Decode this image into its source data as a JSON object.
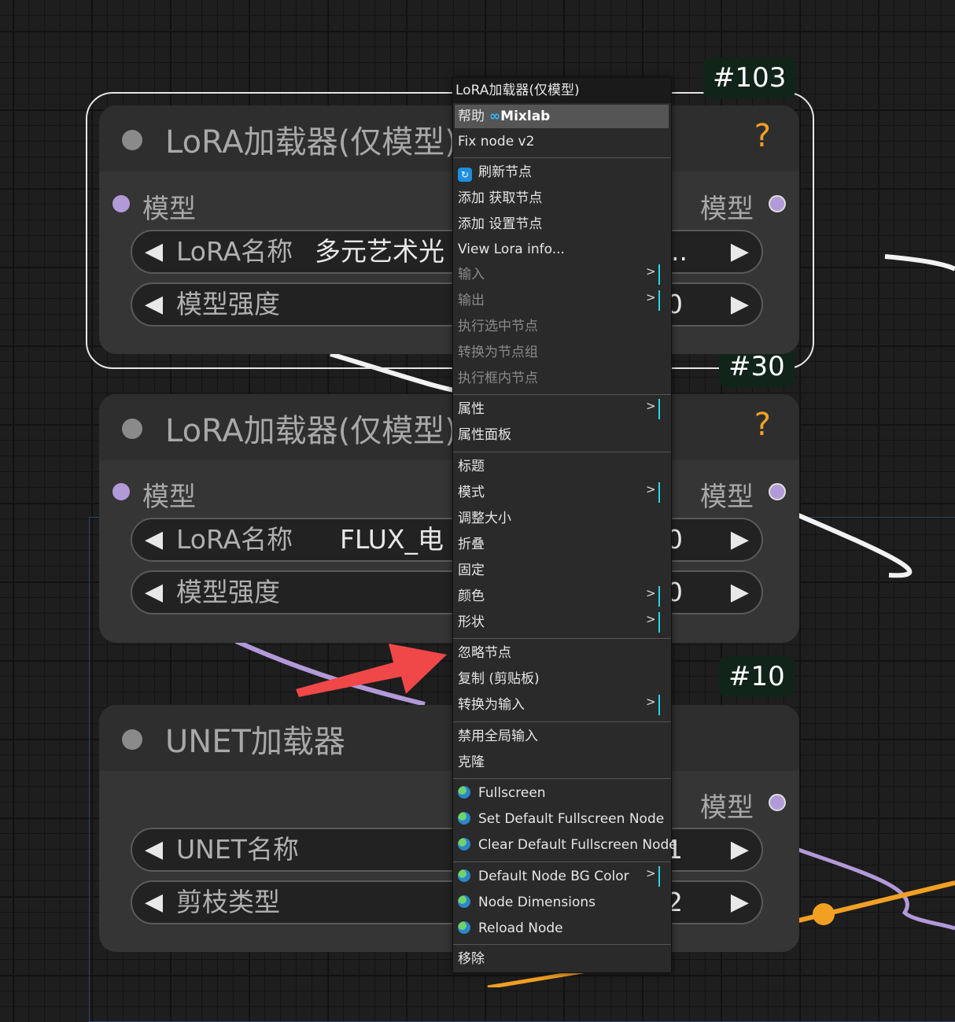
{
  "badges": {
    "node103": "#103",
    "node30": "#30",
    "node10": "#10"
  },
  "nodes": {
    "lora1": {
      "title": "LoRA加载器(仅模型)",
      "help": "?",
      "input_label": "模型",
      "output_label": "模型",
      "widget1": {
        "label": "LoRA名称",
        "value": "多元艺术光",
        "tail": "..."
      },
      "widget2": {
        "label": "模型强度",
        "tail": "0"
      }
    },
    "lora2": {
      "title": "LoRA加载器(仅模型)",
      "help": "?",
      "input_label": "模型",
      "output_label": "模型",
      "widget1": {
        "label": "LoRA名称",
        "value": "FLUX_电",
        "tail": "0"
      },
      "widget2": {
        "label": "模型强度",
        "tail": "0"
      }
    },
    "unet": {
      "title": "UNET加载器",
      "output_label": "模型",
      "widget1": {
        "label": "UNET名称",
        "tail": "1"
      },
      "widget2": {
        "label": "剪枝类型",
        "tail": "2"
      }
    }
  },
  "widget_arrows": {
    "left": "◀",
    "right": "▶"
  },
  "context_menu": {
    "title": "LoRA加载器(仅模型)",
    "help_label": "帮助",
    "mixlab_symbol": "∞",
    "mixlab_label": "Mixlab",
    "submenu_marker": ">",
    "refresh_symbol": "↻",
    "items": {
      "fix_node": "Fix node v2",
      "refresh_node": "刷新节点",
      "add_get_node": "添加 获取节点",
      "add_set_node": "添加 设置节点",
      "view_lora_info": "View Lora info...",
      "inputs": "输入",
      "outputs": "输出",
      "execute_selected": "执行选中节点",
      "convert_to_group": "转换为节点组",
      "execute_in_frame": "执行框内节点",
      "properties": "属性",
      "properties_panel": "属性面板",
      "title": "标题",
      "mode": "模式",
      "resize": "调整大小",
      "collapse": "折叠",
      "pin": "固定",
      "colors": "颜色",
      "shapes": "形状",
      "bypass": "忽略节点",
      "copy_clipspace": "复制 (剪贴板)",
      "convert_to_input": "转换为输入",
      "disable_global_input": "禁用全局输入",
      "clone": "克隆",
      "fullscreen": "Fullscreen",
      "set_default_fullscreen": "Set Default Fullscreen Node",
      "clear_default_fullscreen": "Clear Default Fullscreen Node",
      "default_bg_color": "Default Node BG Color",
      "node_dimensions": "Node Dimensions",
      "reload_node": "Reload Node",
      "remove": "移除"
    }
  },
  "colors": {
    "model_link": "#b29ad9",
    "float_link": "#f2a024",
    "annotation_arrow": "#f04848",
    "submenu_bar": "#2ad6e6",
    "canvas_bg": "#1e1e1e"
  }
}
